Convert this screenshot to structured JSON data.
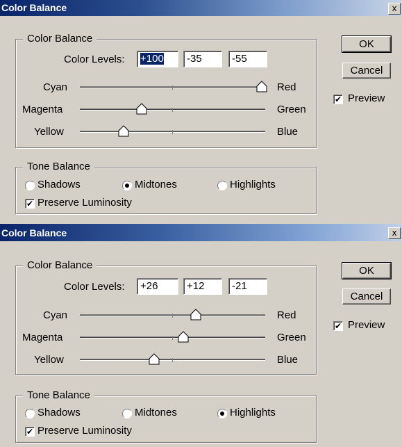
{
  "dialogs": [
    {
      "title": "Color Balance",
      "close_label": "x",
      "color_balance_group": "Color Balance",
      "color_levels_label": "Color Levels:",
      "levels": [
        "+100",
        "-35",
        "-55"
      ],
      "sliders": [
        {
          "left": "Cyan",
          "right": "Red",
          "value": 100
        },
        {
          "left": "Magenta",
          "right": "Green",
          "value": -35
        },
        {
          "left": "Yellow",
          "right": "Blue",
          "value": -55
        }
      ],
      "ok": "OK",
      "cancel": "Cancel",
      "preview": "Preview",
      "preview_checked": true,
      "tone_group": "Tone Balance",
      "tones": [
        "Shadows",
        "Midtones",
        "Highlights"
      ],
      "tone_selected": "Midtones",
      "preserve": "Preserve Luminosity",
      "preserve_checked": true
    },
    {
      "title": "Color Balance",
      "close_label": "x",
      "color_balance_group": "Color Balance",
      "color_levels_label": "Color Levels:",
      "levels": [
        "+26",
        "+12",
        "-21"
      ],
      "sliders": [
        {
          "left": "Cyan",
          "right": "Red",
          "value": 26
        },
        {
          "left": "Magenta",
          "right": "Green",
          "value": 12
        },
        {
          "left": "Yellow",
          "right": "Blue",
          "value": -21
        }
      ],
      "ok": "OK",
      "cancel": "Cancel",
      "preview": "Preview",
      "preview_checked": true,
      "tone_group": "Tone Balance",
      "tones": [
        "Shadows",
        "Midtones",
        "Highlights"
      ],
      "tone_selected": "Highlights",
      "preserve": "Preserve Luminosity",
      "preserve_checked": true
    }
  ],
  "colors": {
    "titlebar_start": "#0a246a",
    "face": "#d4d0c8",
    "selection": "#0a246a"
  }
}
